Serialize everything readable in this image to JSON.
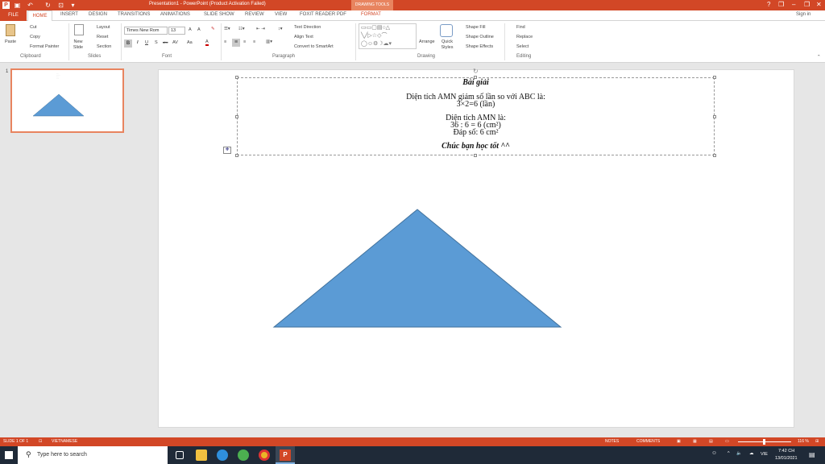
{
  "window": {
    "title": "Presentation1 - PowerPoint (Product Activation Failed)",
    "context_tab_group": "DRAWING TOOLS",
    "sign_in": "Sign in",
    "help": "?",
    "minimize": "–",
    "restore": "❐",
    "close": "✕"
  },
  "tabs": [
    "FILE",
    "HOME",
    "INSERT",
    "DESIGN",
    "TRANSITIONS",
    "ANIMATIONS",
    "SLIDE SHOW",
    "REVIEW",
    "VIEW",
    "FOXIT READER PDF",
    "FORMAT"
  ],
  "ribbon": {
    "clipboard": {
      "label": "Clipboard",
      "paste": "Paste",
      "cut": "Cut",
      "copy": "Copy",
      "format_painter": "Format Painter"
    },
    "slides": {
      "label": "Slides",
      "new_slide": "New Slide",
      "layout": "Layout",
      "reset": "Reset",
      "section": "Section"
    },
    "font": {
      "label": "Font",
      "name": "Times New Rom",
      "size": "13",
      "bold": "B",
      "italic": "I",
      "underline": "U",
      "strike": "S",
      "abc": "abc",
      "spacing": "AV",
      "case": "Aa",
      "color": "A"
    },
    "paragraph": {
      "label": "Paragraph",
      "text_direction": "Text Direction",
      "align_text": "Align Text",
      "convert": "Convert to SmartArt"
    },
    "drawing": {
      "label": "Drawing",
      "arrange": "Arrange",
      "quick_styles": "Quick Styles",
      "shape_fill": "Shape Fill",
      "shape_outline": "Shape Outline",
      "shape_effects": "Shape Effects"
    },
    "editing": {
      "label": "Editing",
      "find": "Find",
      "replace": "Replace",
      "select": "Select"
    }
  },
  "thumbnail": {
    "number": "1"
  },
  "slide": {
    "line1": "Bài giải",
    "line2": "Diện tích AMN giảm số lần so với ABC là:",
    "line3": "3×2=6 (lần)",
    "line4": "Diện tích AMN là:",
    "line5": "36 : 6 = 6 (cm²)",
    "line6": "Đáp số: 6 cm²",
    "line7": "Chúc bạn học tốt ^^",
    "triangle_color": "#5b9bd5"
  },
  "status": {
    "slide": "SLIDE 1 OF 1",
    "language": "VIETNAMESE",
    "notes": "NOTES",
    "comments": "COMMENTS",
    "zoom": "116 %"
  },
  "taskbar": {
    "search_placeholder": "Type here to search",
    "time": "7:42 CH",
    "date": "13/01/2021",
    "lang": "VIE"
  },
  "colors": {
    "accent": "#d24726",
    "taskbar": "#1f2a38"
  }
}
